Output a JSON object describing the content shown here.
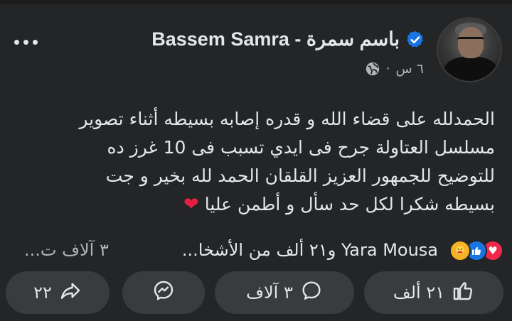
{
  "post": {
    "author_name": "Bassem Samra - باسم سمرة",
    "time": "٦ س",
    "separator": "·",
    "text_lines": [
      "الحمدلله على قضاء الله و قدره إصابه بسيطه أثناء تصوير",
      "مسلسل العتاولة جرح فى ايدي تسبب فى 10 غرز ده",
      "للتوضيح للجمهور العزيز القلقان الحمد لله بخير و جت",
      "بسيطه شكرا لكل حد سأل و أطمن عليا"
    ]
  },
  "reactions": {
    "summary": "Yara Mousa و٢١ ألف من الأشخا...",
    "comments_count": "٣ آلاف ت...",
    "icons": [
      "love",
      "like",
      "care"
    ]
  },
  "actions": {
    "like_count": "٢١ ألف",
    "comment_count": "٣ آلاف",
    "share_count": "٢٢"
  },
  "colors": {
    "background": "#242526",
    "button_bg": "#3a3b3c",
    "verified_blue": "#1b74e4",
    "heart_red": "#e41e3f"
  },
  "icons": {
    "more": "more-dots-icon",
    "verified": "verified-badge-icon",
    "privacy": "globe-icon",
    "like": "thumbs-up-icon",
    "comment": "comment-bubble-icon",
    "messenger": "messenger-icon",
    "share": "share-arrow-icon"
  }
}
